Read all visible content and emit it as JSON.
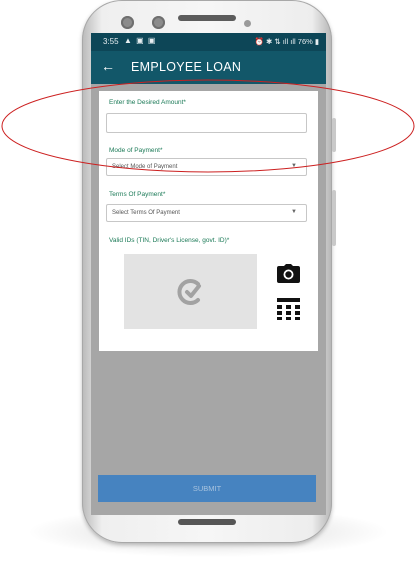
{
  "status_bar": {
    "time": "3:55",
    "left_icons": "▲ ▣ ▣",
    "right_icons": "⏰ ✱ ⇅ ıll ıll 76% ▮"
  },
  "app_bar": {
    "back_icon": "←",
    "title": "EMPLOYEE LOAN"
  },
  "form": {
    "amount_label": "Enter the Desired Amount*",
    "amount_value": "",
    "mode_label": "Mode of Payment*",
    "mode_value": "Select Mode of Payment",
    "terms_label": "Terms Of Payment*",
    "terms_value": "Select Terms Of Payment",
    "ids_label": "Valid IDs (TIN, Driver's License, govt. ID)*"
  },
  "icons": {
    "upload_placeholder": "placeholder-logo-icon",
    "camera": "camera-icon",
    "calendar": "calendar-icon",
    "dropdown": "chevron-down-icon"
  },
  "submit_label": "SUBMIT",
  "colors": {
    "status_bar": "#0d4657",
    "app_bar": "#125769",
    "label_green": "#1b7a57",
    "submit_blue": "#4683c0",
    "annotation_red": "#cc2020"
  }
}
